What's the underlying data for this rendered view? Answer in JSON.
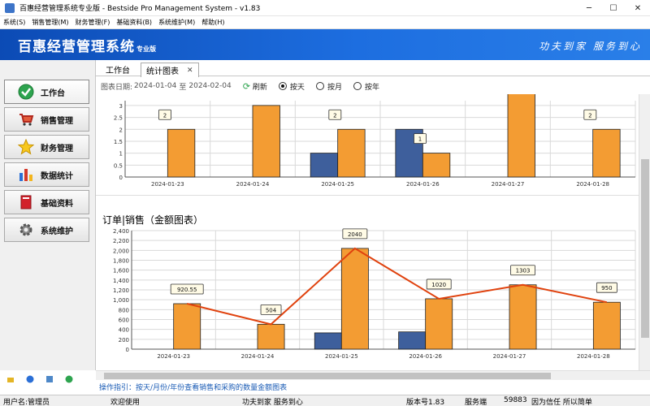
{
  "window": {
    "title": "百惠经营管理系统专业版 - Bestside Pro Management System - v1.83",
    "min": "─",
    "max": "☐",
    "close": "✕"
  },
  "menu": [
    "系统(S)",
    "销售管理(M)",
    "财务管理(F)",
    "基础资料(B)",
    "系统维护(M)",
    "帮助(H)"
  ],
  "banner": {
    "brand": "百惠经营管理系统",
    "brand_suffix": "专业版",
    "slogan": "功夫到家 服务到心"
  },
  "sidebar": {
    "items": [
      {
        "label": "工作台",
        "icon": "check-circle-icon"
      },
      {
        "label": "销售管理",
        "icon": "shopping-cart-icon"
      },
      {
        "label": "财务管理",
        "icon": "star-icon"
      },
      {
        "label": "数据统计",
        "icon": "bar-chart-icon"
      },
      {
        "label": "基础资料",
        "icon": "book-icon"
      },
      {
        "label": "系统维护",
        "icon": "gear-icon"
      }
    ]
  },
  "tabs": [
    {
      "label": "工作台"
    },
    {
      "label": "统计图表",
      "close": "✕"
    }
  ],
  "filter": {
    "label": "图表日期:",
    "date_from": "2024-01-04",
    "separator": "至",
    "date_to": "2024-02-04",
    "refresh": "刷新",
    "options": [
      {
        "label": "按天",
        "selected": true
      },
      {
        "label": "按月",
        "selected": false
      },
      {
        "label": "按年",
        "selected": false
      }
    ]
  },
  "colors": {
    "purchase": "#3e5f9c",
    "sales": "#f39c33",
    "line": "#e0420e",
    "banner": "#1d6ee0"
  },
  "chart_data": [
    {
      "type": "bar",
      "title": "",
      "categories": [
        "2024-01-23",
        "2024-01-24",
        "2024-01-25",
        "2024-01-26",
        "2024-01-27",
        "2024-01-28"
      ],
      "series": [
        {
          "values": [
            0,
            0,
            1,
            2,
            0,
            0
          ]
        },
        {
          "values": [
            2,
            3,
            2,
            1,
            4,
            2
          ]
        }
      ],
      "data_labels": [
        "2",
        "",
        "2",
        "1",
        "",
        "2"
      ],
      "y_ticks": [
        "0",
        "0.5",
        "1",
        "1.5",
        "2",
        "2.5",
        "3"
      ],
      "ylim": [
        0,
        3.2
      ]
    },
    {
      "type": "bar",
      "title": "订单|销售（金额图表）",
      "categories": [
        "2024-01-23",
        "2024-01-24",
        "2024-01-25",
        "2024-01-26",
        "2024-01-27",
        "2024-01-28"
      ],
      "series": [
        {
          "values": [
            0,
            0,
            330,
            350,
            0,
            0
          ]
        },
        {
          "values": [
            920.55,
            504,
            2040,
            1020,
            1303,
            950
          ]
        }
      ],
      "line_values": [
        920.55,
        504,
        2040,
        1020,
        1303,
        950
      ],
      "data_labels": [
        "920.55",
        "504",
        "2040",
        "1020",
        "1303",
        "950"
      ],
      "y_ticks": [
        "0",
        "200",
        "400",
        "600",
        "800",
        "1,000",
        "1,200",
        "1,400",
        "1,600",
        "1,800",
        "2,000",
        "2,200",
        "2,400"
      ],
      "ylim": [
        0,
        2400
      ]
    }
  ],
  "guide": "操作指引：按天/月份/年份查看销售和采购的数量金额图表",
  "status": {
    "user": "用户名:管理员",
    "welcome": "欢迎使用",
    "motto": "功夫到家 服务到心",
    "version": "版本号1.83",
    "service_label": "服务端",
    "service_num": "59883",
    "trust": "因为信任 所以简单"
  }
}
